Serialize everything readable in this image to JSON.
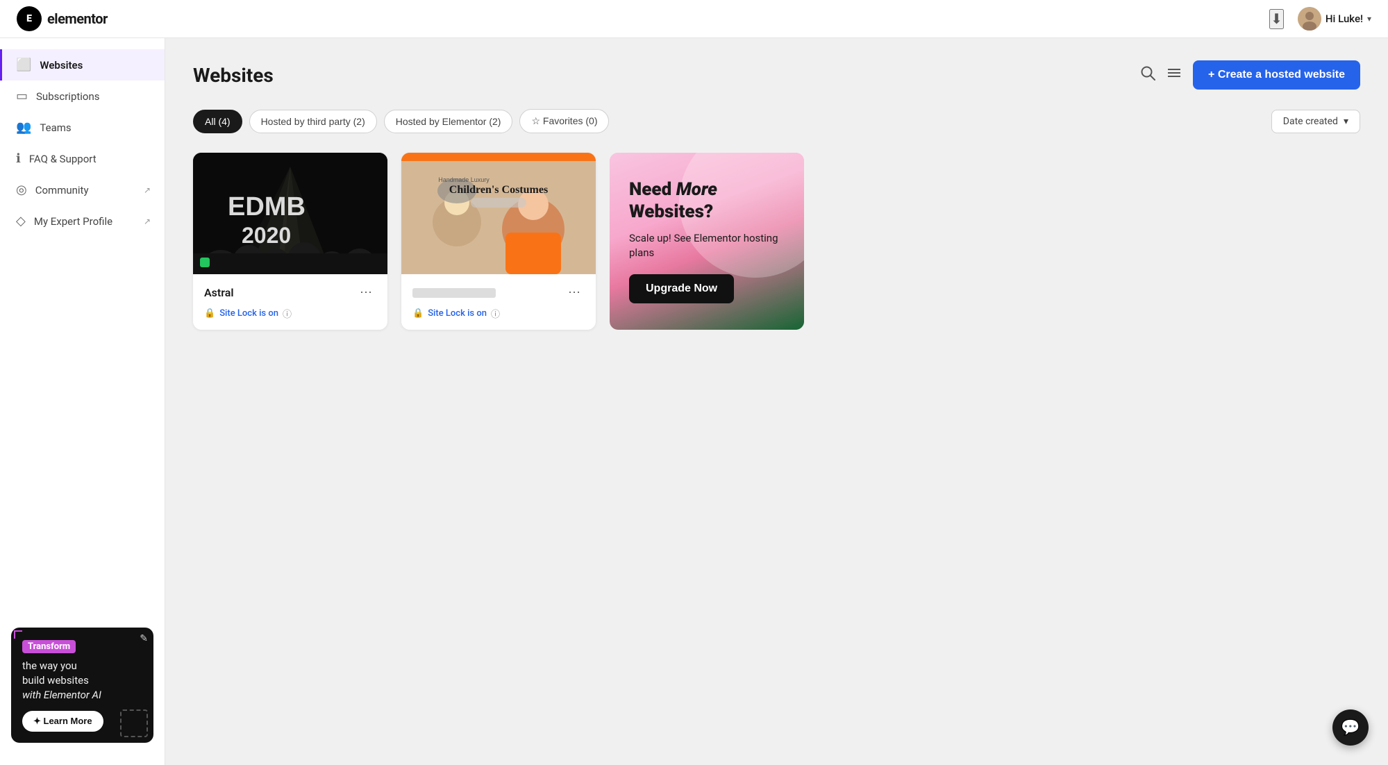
{
  "header": {
    "logo_letter": "E",
    "logo_name": "elementor",
    "user_greeting": "Hi Luke!",
    "download_icon": "⬇",
    "chevron": "▾"
  },
  "sidebar": {
    "items": [
      {
        "id": "websites",
        "label": "Websites",
        "icon": "▣",
        "active": true,
        "external": false
      },
      {
        "id": "subscriptions",
        "label": "Subscriptions",
        "icon": "⬛",
        "active": false,
        "external": false
      },
      {
        "id": "teams",
        "label": "Teams",
        "icon": "👥",
        "active": false,
        "external": false
      },
      {
        "id": "faq",
        "label": "FAQ & Support",
        "icon": "ℹ",
        "active": false,
        "external": false
      },
      {
        "id": "community",
        "label": "Community",
        "icon": "◎",
        "active": false,
        "external": true
      },
      {
        "id": "expert",
        "label": "My Expert Profile",
        "icon": "◇",
        "active": false,
        "external": true
      }
    ],
    "promo": {
      "tag": "Transform",
      "text_part1": "the way you\nbuild websites\n",
      "text_italic": "with Elementor AI",
      "btn_label": "✦ Learn More"
    }
  },
  "main": {
    "page_title": "Websites",
    "search_icon": "🔍",
    "list_view_icon": "☰",
    "create_btn_label": "+ Create a hosted website",
    "filters": [
      {
        "id": "all",
        "label": "All (4)",
        "active": true
      },
      {
        "id": "third_party",
        "label": "Hosted by third party (2)",
        "active": false
      },
      {
        "id": "elementor",
        "label": "Hosted by Elementor (2)",
        "active": false
      },
      {
        "id": "favorites",
        "label": "☆ Favorites (0)",
        "active": false
      }
    ],
    "sort_label": "Date created",
    "sort_chevron": "▾",
    "cards": [
      {
        "id": "astral",
        "type": "astral",
        "title": "Astral",
        "site_lock_text": "Site Lock is on",
        "menu_icon": "⋯"
      },
      {
        "id": "costumes",
        "type": "costumes",
        "title_redacted": true,
        "thumb_title": "Children's Costumes",
        "site_lock_text": "Site Lock is on",
        "menu_icon": "⋯"
      }
    ],
    "upgrade_card": {
      "heading_normal": "Need ",
      "heading_italic": "More",
      "heading_normal2": "\nWebsites?",
      "subtext": "Scale up! See Elementor hosting plans",
      "btn_label": "Upgrade Now"
    }
  },
  "chat": {
    "icon": "💬"
  }
}
